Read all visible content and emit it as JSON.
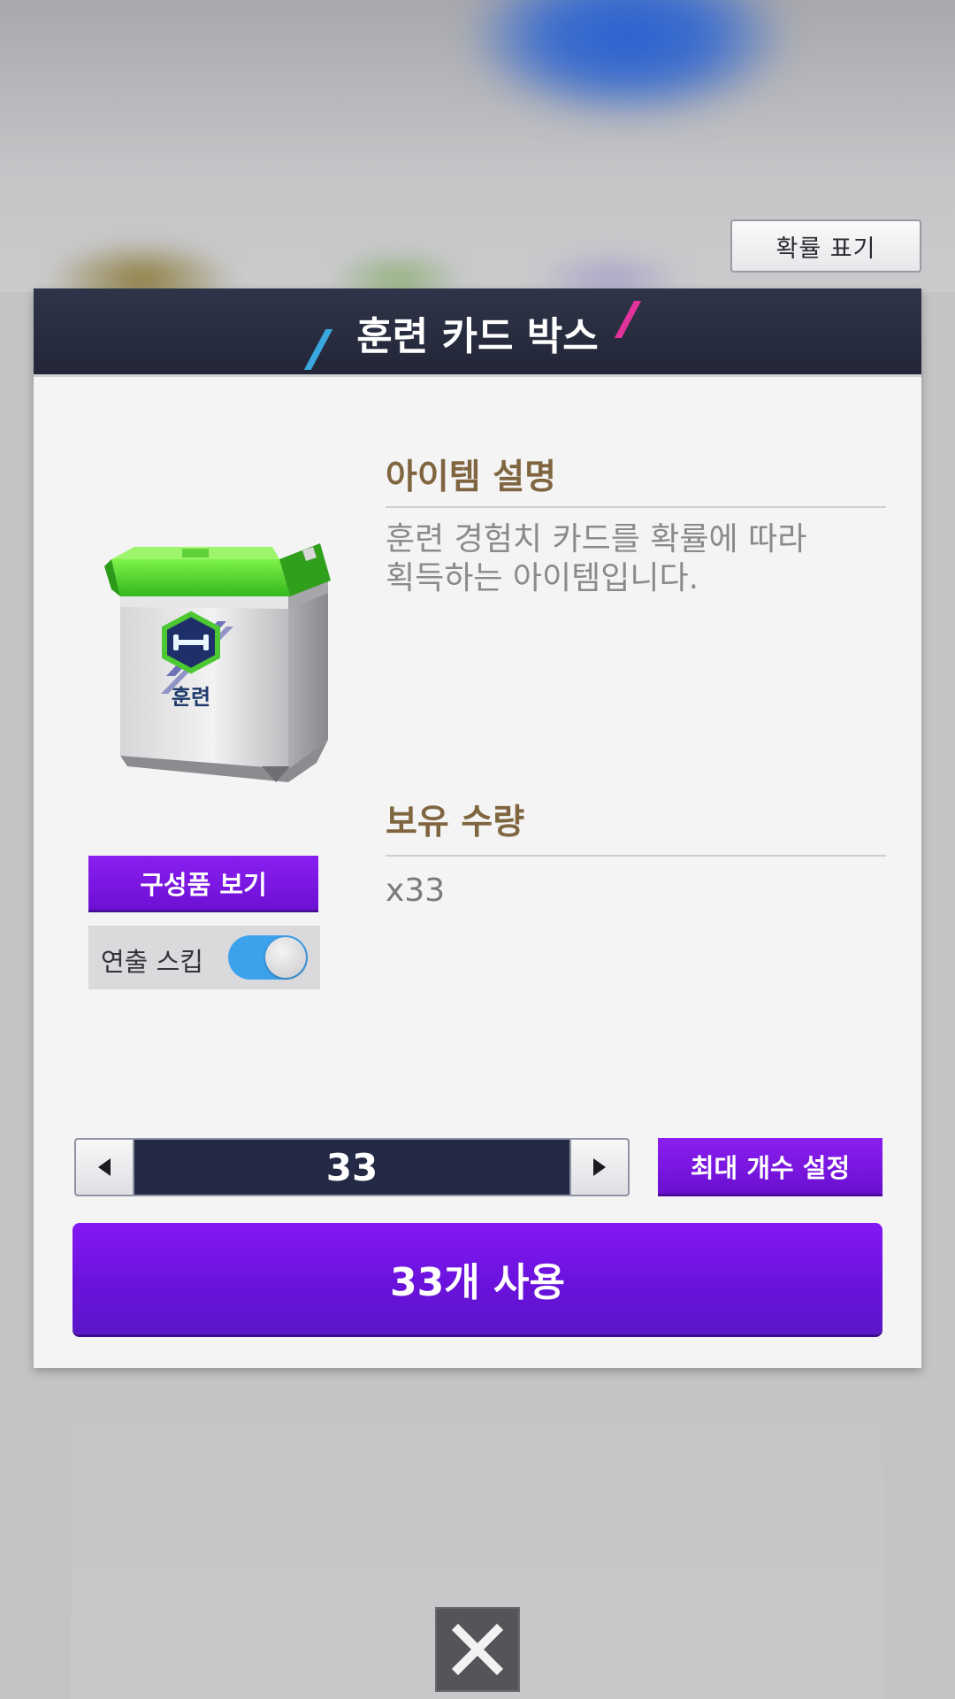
{
  "header_button": {
    "label": "확률 표기"
  },
  "dialog": {
    "title": "훈련 카드 박스",
    "item": {
      "icon": "training-card-box-icon",
      "badge_text": "훈련"
    },
    "description": {
      "heading": "아이템 설명",
      "line1": "훈련 경험치 카드를 확률에 따라",
      "line2": "획득하는 아이템입니다."
    },
    "owned": {
      "heading": "보유 수량",
      "value": "x33"
    },
    "components_button": {
      "label": "구성품 보기"
    },
    "skip": {
      "label": "연출 스킵",
      "enabled": true
    },
    "quantity": {
      "value": "33",
      "decrease_icon": "triangle-left-icon",
      "increase_icon": "triangle-right-icon"
    },
    "max_button": {
      "label": "최대 개수 설정"
    },
    "use_button": {
      "label": "33개 사용"
    }
  },
  "close": {
    "icon": "close-icon"
  },
  "colors": {
    "header_bg": "#262b3e",
    "purple": "#7a16e8",
    "heading_brown": "#806640",
    "toggle_blue": "#3da2ec"
  }
}
